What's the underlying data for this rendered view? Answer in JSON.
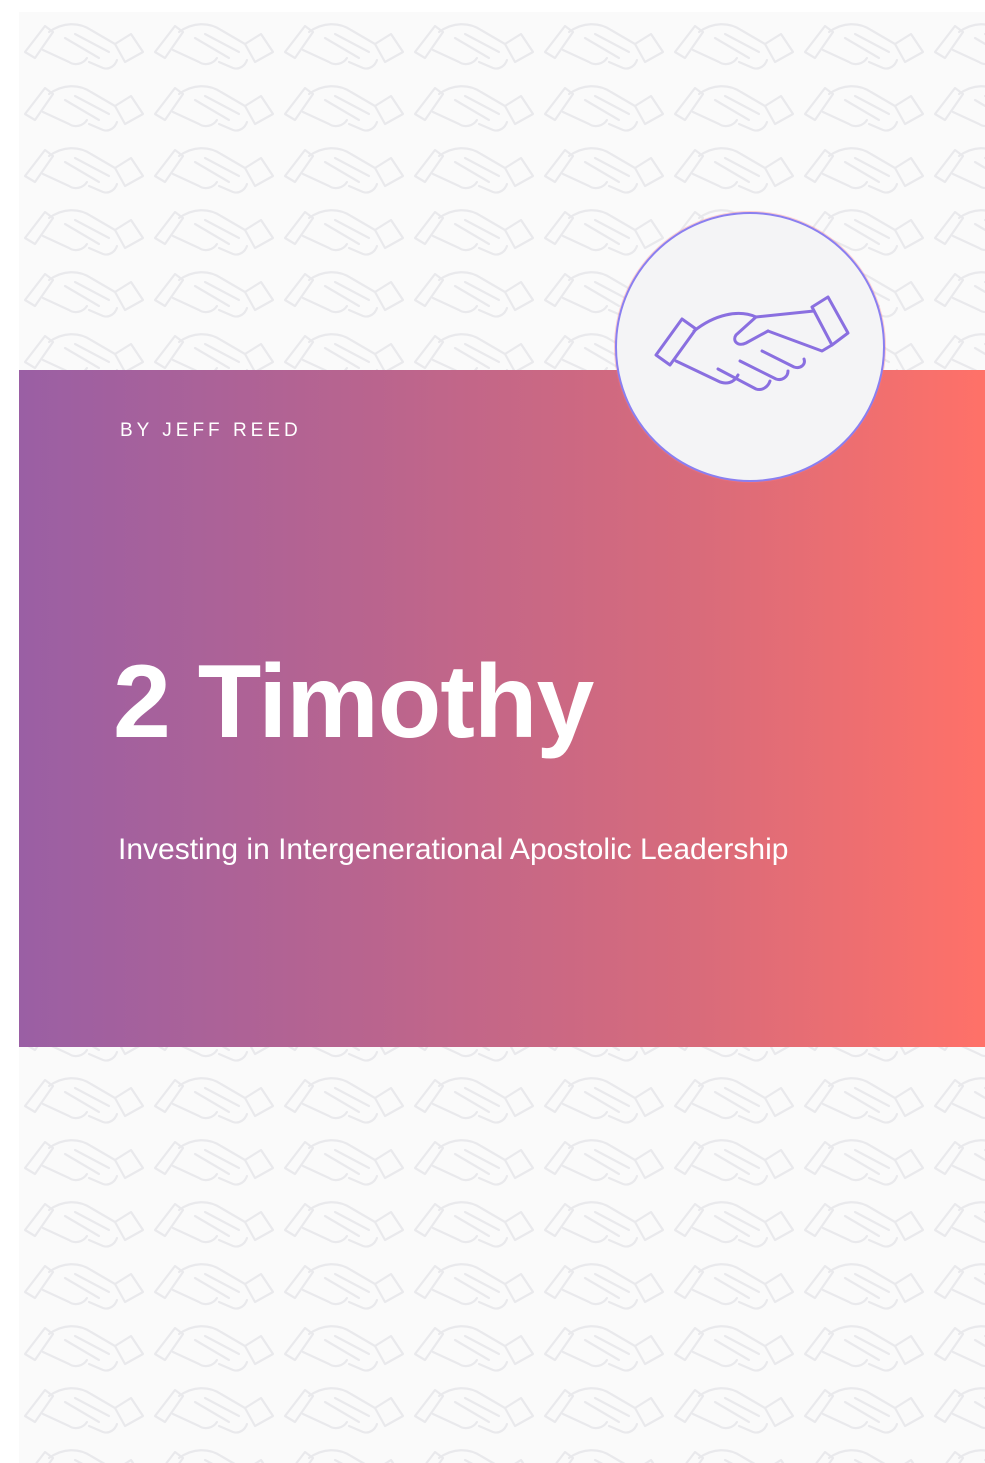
{
  "cover": {
    "author": "BY JEFF REED",
    "title": "2 Timothy",
    "subtitle": "Investing in Intergenerational Apostolic Leadership"
  },
  "icons": {
    "badge_icon": "handshake-icon",
    "pattern_icon": "handshake-pattern"
  },
  "colors": {
    "gradient_start": "#9a5fa4",
    "gradient_end": "#ff7168",
    "badge_fill": "#f4f4f6",
    "badge_outline": "#8a7ff0",
    "icon_stroke": "#8a6fe0"
  }
}
